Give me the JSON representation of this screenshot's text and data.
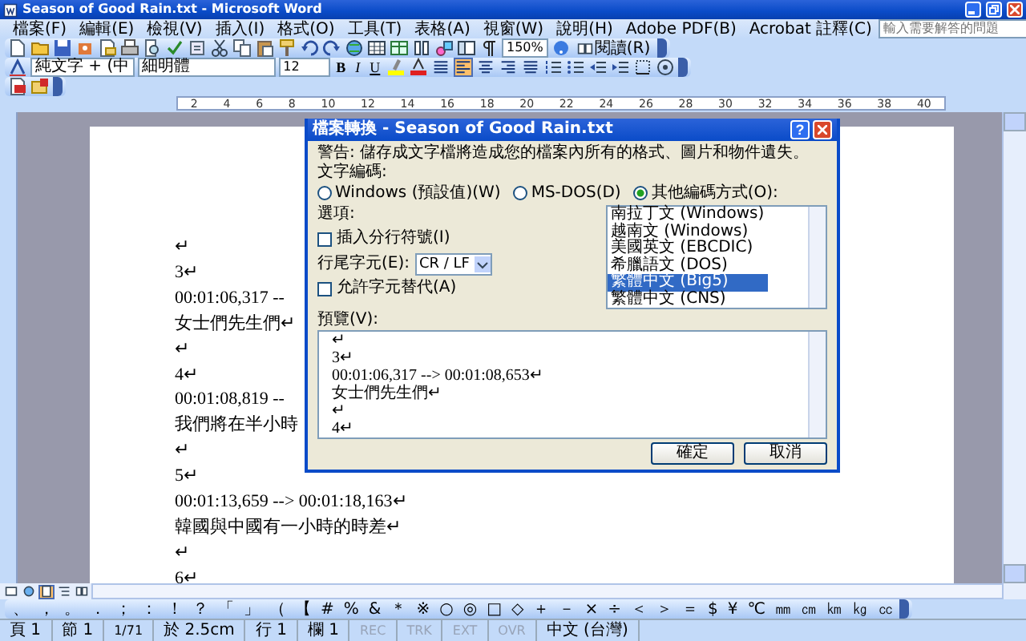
{
  "window": {
    "title": "Season of Good Rain.txt - Microsoft Word"
  },
  "menu": [
    "檔案(F)",
    "編輯(E)",
    "檢視(V)",
    "插入(I)",
    "格式(O)",
    "工具(T)",
    "表格(A)",
    "視窗(W)",
    "說明(H)",
    "Adobe PDF(B)",
    "Acrobat 註釋(C)"
  ],
  "help_search": {
    "placeholder": "輸入需要解答的問題"
  },
  "standard_toolbar": {
    "zoom": "150%",
    "read_button": "閱讀(R)"
  },
  "formatting_toolbar": {
    "style": "純文字 + (中",
    "font": "細明體",
    "size": "12",
    "text_buttons": [
      {
        "label": "B",
        "kind": "bold"
      },
      {
        "label": "I",
        "kind": "italic"
      },
      {
        "label": "U",
        "kind": "underline"
      }
    ],
    "alignment": [
      {
        "kind": "justify",
        "selected": false
      },
      {
        "kind": "left",
        "selected": true
      },
      {
        "kind": "center",
        "selected": false
      },
      {
        "kind": "right",
        "selected": false
      },
      {
        "kind": "distributed",
        "selected": false
      }
    ]
  },
  "ruler": [
    "2",
    "4",
    "6",
    "8",
    "10",
    "12",
    "14",
    "16",
    "18",
    "20",
    "22",
    "24",
    "26",
    "28",
    "30",
    "32",
    "34",
    "36",
    "38",
    "40"
  ],
  "document": {
    "lines": [
      "↵",
      "3↵",
      "00:01:06,317 --",
      "女士們先生們↵",
      "↵",
      "4↵",
      "00:01:08,819 --",
      "我們將在半小時",
      "↵",
      "5↵",
      "00:01:13,659 --> 00:01:18,163↵",
      "韓國與中國有一小時的時差↵",
      "↵",
      "6↵"
    ]
  },
  "dialog": {
    "title": "檔案轉換 - Season of Good Rain.txt",
    "help_button": "?",
    "warning": "警告: 儲存成文字檔將造成您的檔案內所有的格式、圖片和物件遺失。",
    "encoding_label": "文字編碼:",
    "encodings": [
      {
        "label": "Windows (預設值)(W)",
        "selected": false
      },
      {
        "label": "MS-DOS(D)",
        "selected": false
      },
      {
        "label": "其他編碼方式(O):",
        "selected": true
      }
    ],
    "encoding_list": [
      {
        "label": "南拉丁文 (Windows)",
        "selected": false
      },
      {
        "label": "越南文 (Windows)",
        "selected": false
      },
      {
        "label": "美國英文 (EBCDIC)",
        "selected": false
      },
      {
        "label": "希臘語文 (DOS)",
        "selected": false
      },
      {
        "label": "繁體中文 (Big5)",
        "selected": true
      },
      {
        "label": "繁體中文 (CNS)",
        "selected": false
      }
    ],
    "options_label": "選項:",
    "insert_line_breaks": {
      "label": "插入分行符號(I)",
      "checked": false
    },
    "line_ending": {
      "label": "行尾字元(E):",
      "value": "CR / LF"
    },
    "allow_substitution": {
      "label": "允許字元替代(A)",
      "checked": false
    },
    "preview_label": "預覽(V):",
    "preview_lines": [
      "↵",
      "3↵",
      "00:01:06,317 --> 00:01:08,653↵",
      "女士們先生們↵",
      "↵",
      "4↵"
    ],
    "buttons": [
      "確定",
      "取消"
    ]
  },
  "view_modes": [
    {
      "kind": "normal",
      "selected": false
    },
    {
      "kind": "web",
      "selected": false
    },
    {
      "kind": "print",
      "selected": true
    },
    {
      "kind": "outline",
      "selected": false
    },
    {
      "kind": "reading",
      "selected": false
    }
  ],
  "symbols": [
    "、",
    "，",
    "。",
    "．",
    "；",
    "：",
    "！",
    "？",
    "「",
    "」",
    "（",
    "【",
    "#",
    "%",
    "&",
    "＊",
    "※",
    "○",
    "◎",
    "□",
    "◇",
    "＋",
    "－",
    "×",
    "÷",
    "＜",
    "＞",
    "＝",
    "$",
    "¥",
    "℃",
    "㎜",
    "㎝",
    "㎞",
    "㎏",
    "㏄"
  ],
  "status_bar": [
    {
      "text": "頁 1",
      "disabled": false
    },
    {
      "text": "節 1",
      "disabled": false
    },
    {
      "text": "1/71",
      "disabled": false
    },
    {
      "text": "於 2.5cm",
      "disabled": false
    },
    {
      "text": "行 1",
      "disabled": false
    },
    {
      "text": "欄 1",
      "disabled": false
    },
    {
      "text": "REC",
      "disabled": true
    },
    {
      "text": "TRK",
      "disabled": true
    },
    {
      "text": "EXT",
      "disabled": true
    },
    {
      "text": "OVR",
      "disabled": true
    },
    {
      "text": "中文 (台灣)",
      "disabled": false
    }
  ]
}
